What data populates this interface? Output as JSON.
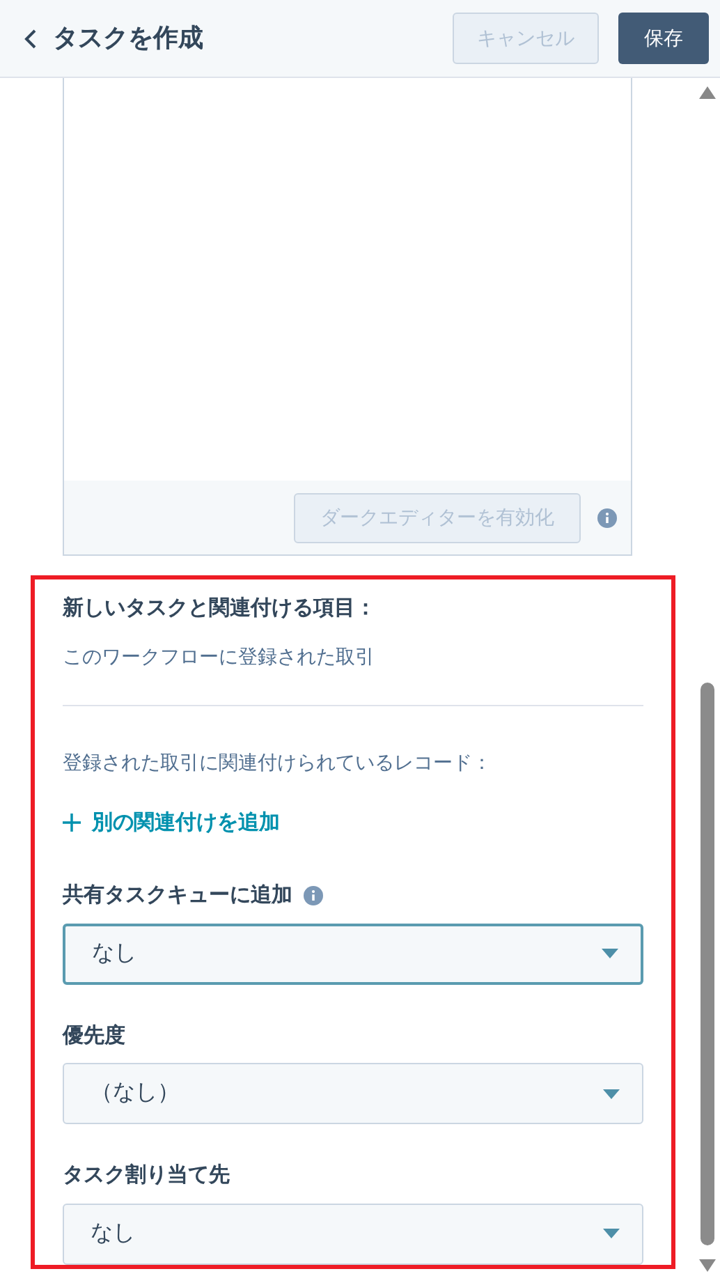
{
  "header": {
    "title": "タスクを作成",
    "cancel": "キャンセル",
    "save": "保存"
  },
  "editor": {
    "dark_button": "ダークエディターを有効化"
  },
  "associations": {
    "heading": "新しいタスクと関連付ける項目：",
    "value": "このワークフローに登録された取引",
    "records_label": "登録された取引に関連付けられているレコード：",
    "add_link": "別の関連付けを追加"
  },
  "fields": [
    {
      "label": "共有タスクキューに追加",
      "info": true,
      "value": "なし",
      "focused": true
    },
    {
      "label": "優先度",
      "info": false,
      "value": "（なし）",
      "focused": false
    },
    {
      "label": "タスク割り当て先",
      "info": false,
      "value": "なし",
      "focused": false
    }
  ]
}
